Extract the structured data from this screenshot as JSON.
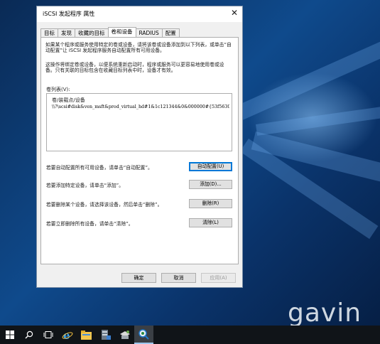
{
  "dialog": {
    "title": "iSCSI 发起程序 属性",
    "close_glyph": "✕"
  },
  "tabs": [
    {
      "label": "目标",
      "active": false
    },
    {
      "label": "发现",
      "active": false
    },
    {
      "label": "收藏的目标",
      "active": false
    },
    {
      "label": "卷和设备",
      "active": true
    },
    {
      "label": "RADIUS",
      "active": false
    },
    {
      "label": "配置",
      "active": false
    }
  ],
  "panel": {
    "intro_1": "如果某个程序或服务使用特定的卷或设备，请将该卷或设备添加到以下列表，或单击“自动配置”让 iSCSI 发起程序服务自动配置所有可用设备。",
    "intro_2": "这操作将绑定卷或设备，以便系统重新启动时，程序或服务可以更容易地使用卷或设备。只有关联的目标包含在收藏目标列表中时，设备才有效。",
    "volume_list_label": "卷列表(V):",
    "volume_list_header": "卷/装载点/设备",
    "volume_items": [
      "\\\\?\\scsi#disk&ven_msft&prod_virtual_hd#1&1c121344&0&000000#{53f5630..."
    ]
  },
  "actions": {
    "autoconfig_text": "若要自动配置所有可用设备，请单击“自动配置”。",
    "autoconfig_btn": "自动配置(U)",
    "add_text": "若要添加特定设备，请单击“添加”。",
    "add_btn": "添加(D)...",
    "remove_text": "若要删除某个设备，请选择该设备，然后单击“删除”。",
    "remove_btn": "删除(R)",
    "clear_text": "若要立即删除所有设备，请单击“清除”。",
    "clear_btn": "清除(L)"
  },
  "footer": {
    "ok": "确定",
    "cancel": "取消",
    "apply": "应用(A)"
  },
  "desktop": {
    "watermark": "gavin"
  },
  "taskbar": {
    "items": [
      "windows-icon",
      "search-icon",
      "task-view-icon",
      "internet-explorer-icon",
      "file-explorer-icon",
      "server-manager-icon",
      "tools-icon",
      "iscsi-initiator-icon"
    ]
  },
  "colors": {
    "accent": "#0078d7",
    "desktop": "#0f4a8c",
    "taskbar": "#101418"
  }
}
